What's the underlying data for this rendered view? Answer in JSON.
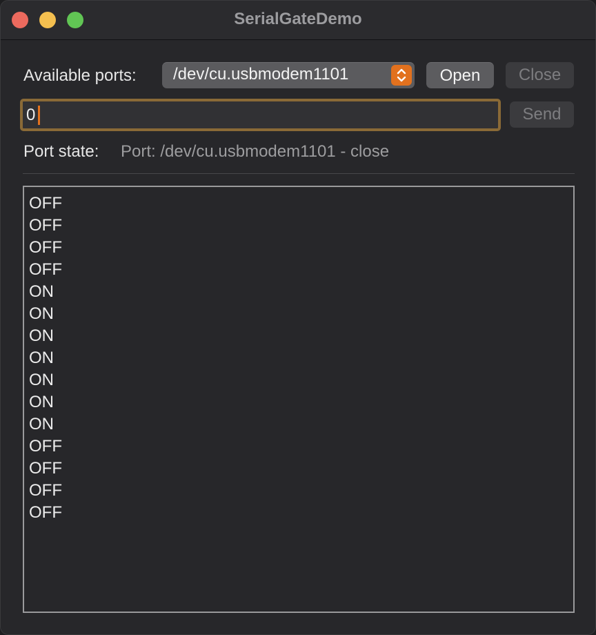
{
  "window": {
    "title": "SerialGateDemo"
  },
  "ports": {
    "label": "Available ports:",
    "selected": "/dev/cu.usbmodem1101",
    "open_label": "Open",
    "close_label": "Close"
  },
  "send": {
    "input_value": "0",
    "send_label": "Send"
  },
  "state": {
    "label": "Port state:",
    "value": "Port: /dev/cu.usbmodem1101 - close"
  },
  "log": {
    "lines": [
      "OFF",
      "OFF",
      "OFF",
      "OFF",
      "ON",
      "ON",
      "ON",
      "ON",
      "ON",
      "ON",
      "ON",
      "OFF",
      "OFF",
      "OFF",
      "OFF"
    ]
  },
  "colors": {
    "traffic_close": "#ec6a5e",
    "traffic_minimize": "#f4bf4f",
    "traffic_maximize": "#61c554",
    "accent": "#e2711e",
    "focus_ring": "#8a6a37"
  }
}
